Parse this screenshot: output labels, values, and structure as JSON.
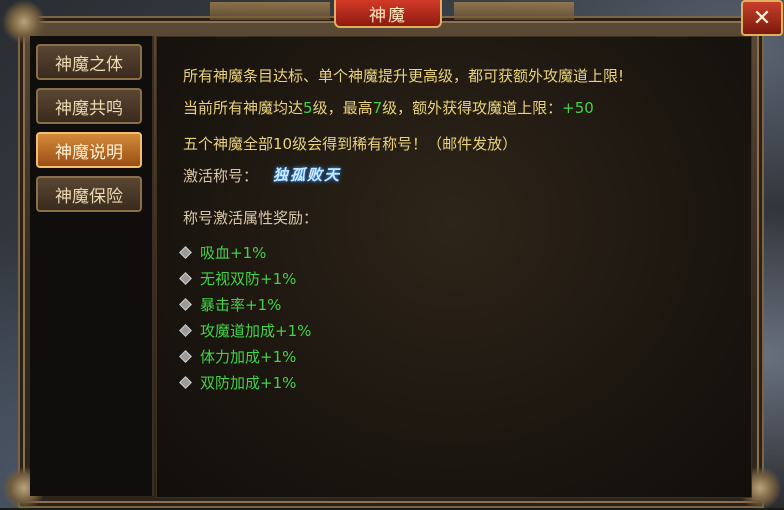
{
  "window": {
    "title": "神魔",
    "close_label": "✕"
  },
  "sidebar": {
    "items": [
      {
        "label": "神魔之体",
        "active": false
      },
      {
        "label": "神魔共鸣",
        "active": false
      },
      {
        "label": "神魔说明",
        "active": true
      },
      {
        "label": "神魔保险",
        "active": false
      }
    ]
  },
  "content": {
    "line1": "所有神魔条目达标、单个神魔提升更高级，都可获额外攻魔道上限!",
    "line2": {
      "prefix": "当前所有神魔均达",
      "avg_level": "5",
      "mid1": "级，最高",
      "max_level": "7",
      "mid2": "级，额外获得攻魔道上限：",
      "bonus": "+50"
    },
    "line3": "五个神魔全部10级会得到稀有称号！（邮件发放）",
    "activate_label": "激活称号：",
    "title_name": "独孤败天",
    "attr_header": "称号激活属性奖励：",
    "bonuses": [
      "吸血+1%",
      "无视双防+1%",
      "暴击率+1%",
      "攻魔道加成+1%",
      "体力加成+1%",
      "双防加成+1%"
    ]
  },
  "colors": {
    "highlight": "#e8d27a",
    "value": "#44d04a",
    "active_tab": "#d48a3a"
  }
}
